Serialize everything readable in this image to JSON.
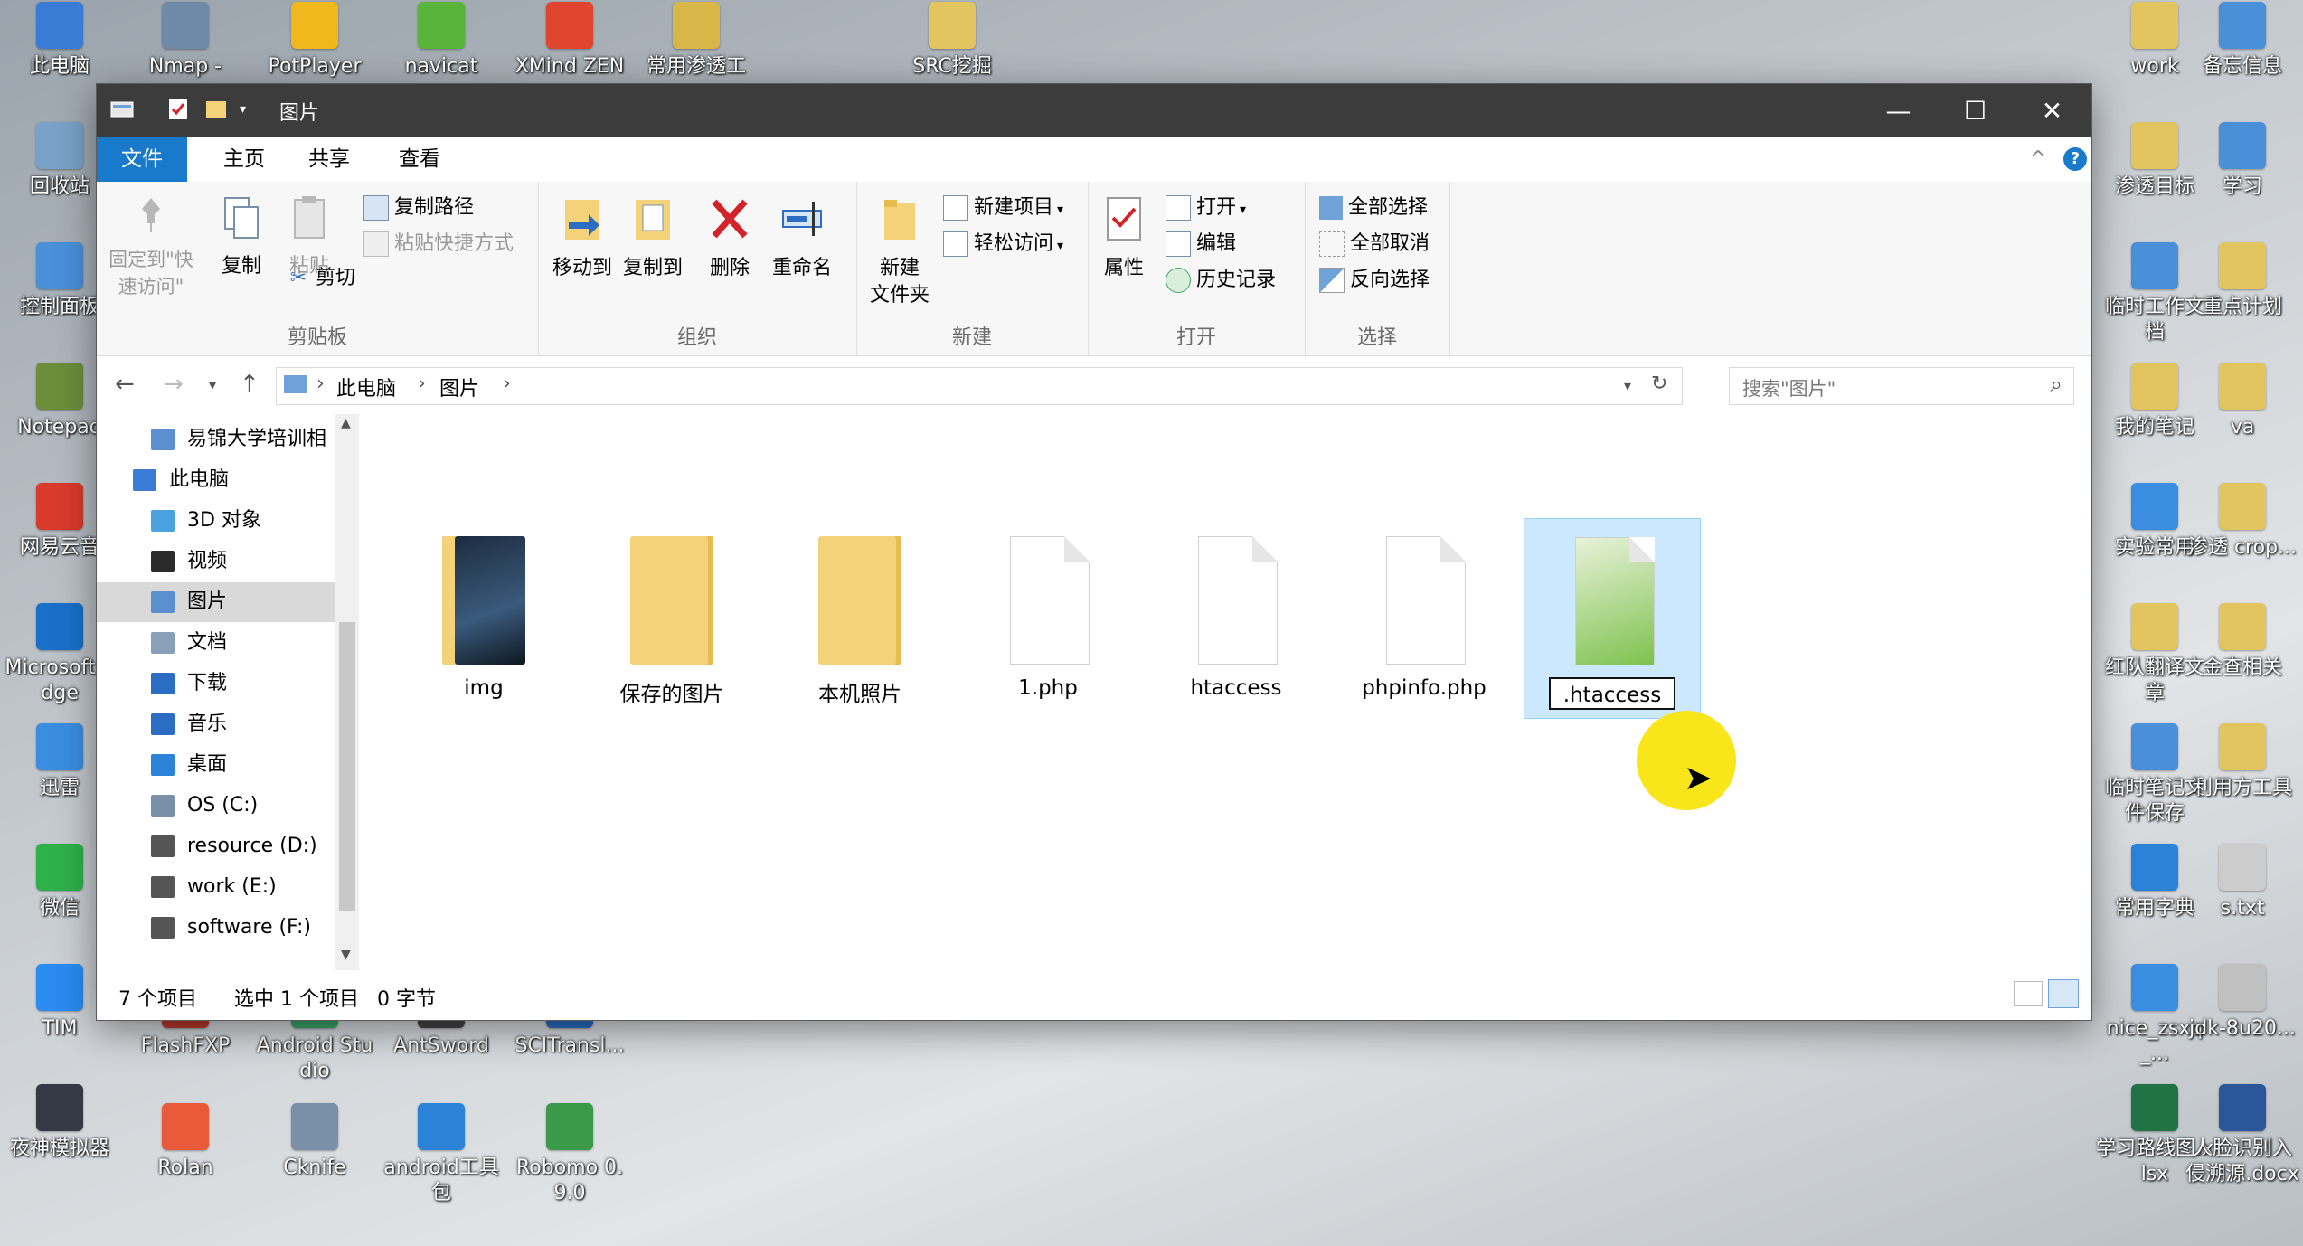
{
  "desktop": {
    "left_icons": [
      {
        "label": "此电脑",
        "icon": "computer-icon",
        "color": "#3a7bd5"
      },
      {
        "label": "回收站",
        "icon": "recycle-bin-icon",
        "color": "#7aa1c8"
      },
      {
        "label": "控制面板",
        "icon": "control-panel-icon",
        "color": "#4a90d9"
      },
      {
        "label": "Notepad",
        "icon": "notepad-icon",
        "color": "#6c8e3a"
      },
      {
        "label": "网易云音",
        "icon": "netease-music-icon",
        "color": "#d93a2b"
      },
      {
        "label": "Microsoft Edge",
        "icon": "edge-icon",
        "color": "#1a6fc9"
      },
      {
        "label": "迅雷",
        "icon": "xunlei-icon",
        "color": "#3a8de0"
      },
      {
        "label": "微信",
        "icon": "wechat-icon",
        "color": "#2fb14a"
      },
      {
        "label": "TIM",
        "icon": "tim-icon",
        "color": "#2a8bf0"
      },
      {
        "label": "夜神模拟器",
        "icon": "nox-icon",
        "color": "#333a44"
      }
    ],
    "top_icons": [
      {
        "label": "Nmap -",
        "icon": "nmap-icon",
        "color": "#6f8aa6"
      },
      {
        "label": "PotPlayer",
        "icon": "potplayer-icon",
        "color": "#f0b81c"
      },
      {
        "label": "navicat",
        "icon": "navicat-icon",
        "color": "#5bb43a"
      },
      {
        "label": "XMind ZEN",
        "icon": "xmind-icon",
        "color": "#e0452f"
      },
      {
        "label": "常用渗透工",
        "icon": "tools-folder-icon",
        "color": "#d8b648"
      },
      {
        "label": "SRC挖掘",
        "icon": "src-folder-icon",
        "color": "#e3c560"
      }
    ],
    "bottom_icons": [
      {
        "label": "FlashFXP",
        "icon": "flashfxp-icon",
        "color": "#b83a2c"
      },
      {
        "label": "Android Studio",
        "icon": "android-studio-icon",
        "color": "#3aa56a"
      },
      {
        "label": "AntSword",
        "icon": "antsword-icon",
        "color": "#444"
      },
      {
        "label": "SCITransl...",
        "icon": "scitrans-icon",
        "color": "#2a6dc2"
      },
      {
        "label": "Rolan",
        "icon": "rolan-icon",
        "color": "#e85a3a"
      },
      {
        "label": "Cknife",
        "icon": "cknife-icon",
        "color": "#7a8fa8"
      },
      {
        "label": "android工具包",
        "icon": "android-tools-icon",
        "color": "#2a83d6"
      },
      {
        "label": "Robomo 0.9.0",
        "icon": "robomongo-icon",
        "color": "#3a9a4a"
      }
    ],
    "right_icons": [
      {
        "label": "work",
        "icon": "work-folder-icon",
        "color": "#e3c560"
      },
      {
        "label": "备忘信息",
        "icon": "memo-icon",
        "color": "#4a90d9"
      },
      {
        "label": "渗透目标",
        "icon": "target-folder-icon",
        "color": "#e3c560"
      },
      {
        "label": "学习",
        "icon": "study-icon",
        "color": "#4a90d9"
      },
      {
        "label": "临时工作文档",
        "icon": "temp-work-icon",
        "color": "#4a90d9"
      },
      {
        "label": "重点计划",
        "icon": "key-plan-icon",
        "color": "#e3c560"
      },
      {
        "label": "我的笔记",
        "icon": "notes-folder-icon",
        "color": "#e3c560"
      },
      {
        "label": "va",
        "icon": "va-icon",
        "color": "#e3c560"
      },
      {
        "label": "实验常用",
        "icon": "lab-icon",
        "color": "#3a8de0"
      },
      {
        "label": "渗透 crop...",
        "icon": "crop-icon",
        "color": "#e3c560"
      },
      {
        "label": "红队翻译文章",
        "icon": "redteam-folder-icon",
        "color": "#e3c560"
      },
      {
        "label": "金查相关",
        "icon": "check-icon",
        "color": "#e3c560"
      },
      {
        "label": "临时笔记文件保存",
        "icon": "temp-notes-icon",
        "color": "#4a90d9"
      },
      {
        "label": "利用方工具",
        "icon": "exploit-tools-icon",
        "color": "#e3c560"
      },
      {
        "label": "常用字典",
        "icon": "dict-icon",
        "color": "#2a83d6"
      },
      {
        "label": "s.txt",
        "icon": "txt-icon",
        "color": "#ccc"
      },
      {
        "label": "nice_zsxq_...",
        "icon": "zsxq-icon",
        "color": "#3a8de0"
      },
      {
        "label": "jdk-8u20...",
        "icon": "jdk-icon",
        "color": "#c0c0c0"
      },
      {
        "label": "学习路线图.xlsx",
        "icon": "excel-icon",
        "color": "#217346"
      },
      {
        "label": "人脸识别入侵溯源.docx",
        "icon": "word-icon",
        "color": "#2b579a"
      }
    ]
  },
  "window": {
    "title": "图片",
    "tabs": [
      "文件",
      "主页",
      "共享",
      "查看"
    ],
    "ribbon": {
      "clipboard": {
        "group_name": "剪贴板",
        "pin": "固定到\"快速访问\"",
        "copy": "复制",
        "paste": "粘贴",
        "copy_path": "复制路径",
        "paste_shortcut": "粘贴快捷方式",
        "cut": "剪切"
      },
      "organize": {
        "group_name": "组织",
        "move_to": "移动到",
        "copy_to": "复制到",
        "delete": "删除",
        "rename": "重命名"
      },
      "new": {
        "group_name": "新建",
        "new_folder": "新建\n文件夹",
        "new_item": "新建项目",
        "easy_access": "轻松访问"
      },
      "open": {
        "group_name": "打开",
        "properties": "属性",
        "open": "打开",
        "edit": "编辑",
        "history": "历史记录"
      },
      "select": {
        "group_name": "选择",
        "select_all": "全部选择",
        "select_none": "全部取消",
        "invert": "反向选择"
      }
    },
    "address": {
      "crumbs": [
        "此电脑",
        "图片"
      ],
      "search_placeholder": "搜索\"图片\""
    },
    "nav": [
      {
        "label": "易锦大学培训相",
        "icon": "quick-access-icon",
        "color": "#5b8fd0",
        "indent": 1
      },
      {
        "label": "此电脑",
        "icon": "computer-icon",
        "color": "#3a7bd5",
        "indent": 0
      },
      {
        "label": "3D 对象",
        "icon": "3d-objects-icon",
        "color": "#4aa3df",
        "indent": 1
      },
      {
        "label": "视频",
        "icon": "video-icon",
        "color": "#2b2b2b",
        "indent": 1
      },
      {
        "label": "图片",
        "icon": "pictures-icon",
        "color": "#5b8fd0",
        "indent": 1,
        "selected": true
      },
      {
        "label": "文档",
        "icon": "documents-icon",
        "color": "#8aa0b8",
        "indent": 1
      },
      {
        "label": "下载",
        "icon": "downloads-icon",
        "color": "#2a6dc2",
        "indent": 1
      },
      {
        "label": "音乐",
        "icon": "music-icon",
        "color": "#2a6dc2",
        "indent": 1
      },
      {
        "label": "桌面",
        "icon": "desktop-icon",
        "color": "#2a83d6",
        "indent": 1
      },
      {
        "label": "OS (C:)",
        "icon": "drive-c-icon",
        "color": "#7a8fa8",
        "indent": 1
      },
      {
        "label": "resource (D:)",
        "icon": "drive-icon",
        "color": "#555",
        "indent": 1
      },
      {
        "label": "work (E:)",
        "icon": "drive-icon",
        "color": "#555",
        "indent": 1
      },
      {
        "label": "software (F:)",
        "icon": "drive-icon",
        "color": "#555",
        "indent": 1
      }
    ],
    "files": [
      {
        "name": "img",
        "type": "folder-dark"
      },
      {
        "name": "保存的图片",
        "type": "folder"
      },
      {
        "name": "本机照片",
        "type": "folder"
      },
      {
        "name": "1.php",
        "type": "doc"
      },
      {
        "name": "htaccess",
        "type": "doc"
      },
      {
        "name": "phpinfo.php",
        "type": "doc"
      },
      {
        "name": ".htaccess",
        "type": "notepad",
        "selected": true,
        "renaming": true
      }
    ],
    "status": {
      "count": "7 个项目",
      "selected": "选中 1 个项目",
      "size": "0 字节"
    }
  }
}
